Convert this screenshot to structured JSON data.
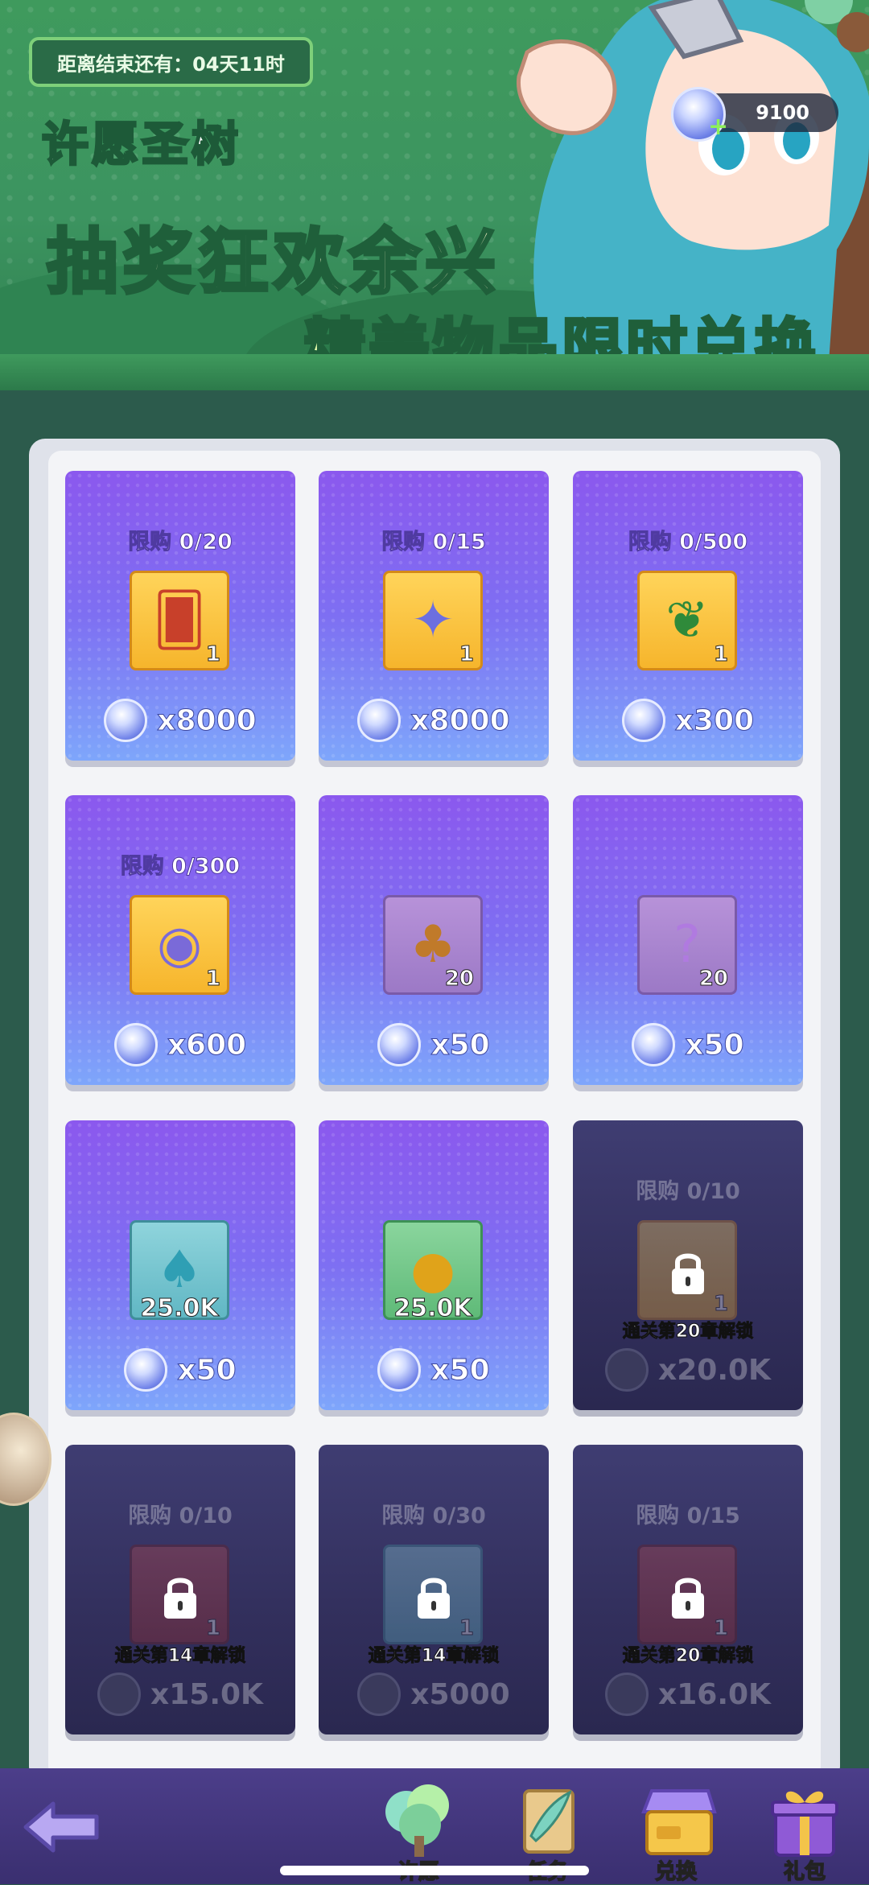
{
  "banner": {
    "timer_label": "距离结束还有：04天11时",
    "event_title": "许愿圣树",
    "headline": "抽奖狂欢余兴",
    "headline2": "精美物品限时兑换",
    "currency_amount": "9100"
  },
  "shop": {
    "items": [
      {
        "limit": "限购 0/20",
        "qty": "1",
        "price": "x8000",
        "icon": "card-icon",
        "tile": "gold"
      },
      {
        "limit": "限购 0/15",
        "qty": "1",
        "price": "x8000",
        "icon": "star-crystal-icon",
        "tile": "gold"
      },
      {
        "limit": "限购 0/500",
        "qty": "1",
        "price": "x300",
        "icon": "pearl-leaf-icon",
        "tile": "gold"
      },
      {
        "limit": "限购 0/300",
        "qty": "1",
        "price": "x600",
        "icon": "horn-orb-icon",
        "tile": "gold"
      },
      {
        "limit": "",
        "qty": "20",
        "price": "x50",
        "icon": "mushroom-pendant-icon",
        "tile": "pinkish"
      },
      {
        "limit": "",
        "qty": "20",
        "price": "x50",
        "icon": "mystery-shard-icon",
        "tile": "pinkish"
      },
      {
        "limit": "",
        "qty": "25.0K",
        "price": "x50",
        "icon": "blue-flame-mushroom-icon",
        "tile": "teal"
      },
      {
        "limit": "",
        "qty": "25.0K",
        "price": "x50",
        "icon": "gold-coin-icon",
        "tile": "green"
      },
      {
        "limit": "限购 0/10",
        "qty": "1",
        "price": "x20.0K",
        "icon": "lock-icon",
        "tile": "gold",
        "locked": true,
        "lock_text": "通关第20章解锁"
      },
      {
        "limit": "限购 0/10",
        "qty": "1",
        "price": "x15.0K",
        "icon": "lock-icon",
        "tile": "red",
        "locked": true,
        "lock_text": "通关第14章解锁"
      },
      {
        "limit": "限购 0/30",
        "qty": "1",
        "price": "x5000",
        "icon": "lock-icon",
        "tile": "teal",
        "locked": true,
        "lock_text": "通关第14章解锁"
      },
      {
        "limit": "限购 0/15",
        "qty": "1",
        "price": "x16.0K",
        "icon": "lock-icon",
        "tile": "red",
        "locked": true,
        "lock_text": "通关第20章解锁"
      }
    ]
  },
  "nav": {
    "back_icon": "back-arrow-icon",
    "tabs": [
      {
        "label": "许愿",
        "icon": "wish-tree-icon"
      },
      {
        "label": "任务",
        "icon": "quest-scroll-icon"
      },
      {
        "label": "兑换",
        "icon": "shop-icon",
        "selected": true
      },
      {
        "label": "礼包",
        "icon": "gift-box-icon"
      }
    ]
  },
  "colors": {
    "card_top": "#8b58ee",
    "card_bottom": "#7ea6fb",
    "locked_card": "#322f5c",
    "banner_green": "#3f9a5d",
    "nav_bg": "#4c3e8a"
  }
}
